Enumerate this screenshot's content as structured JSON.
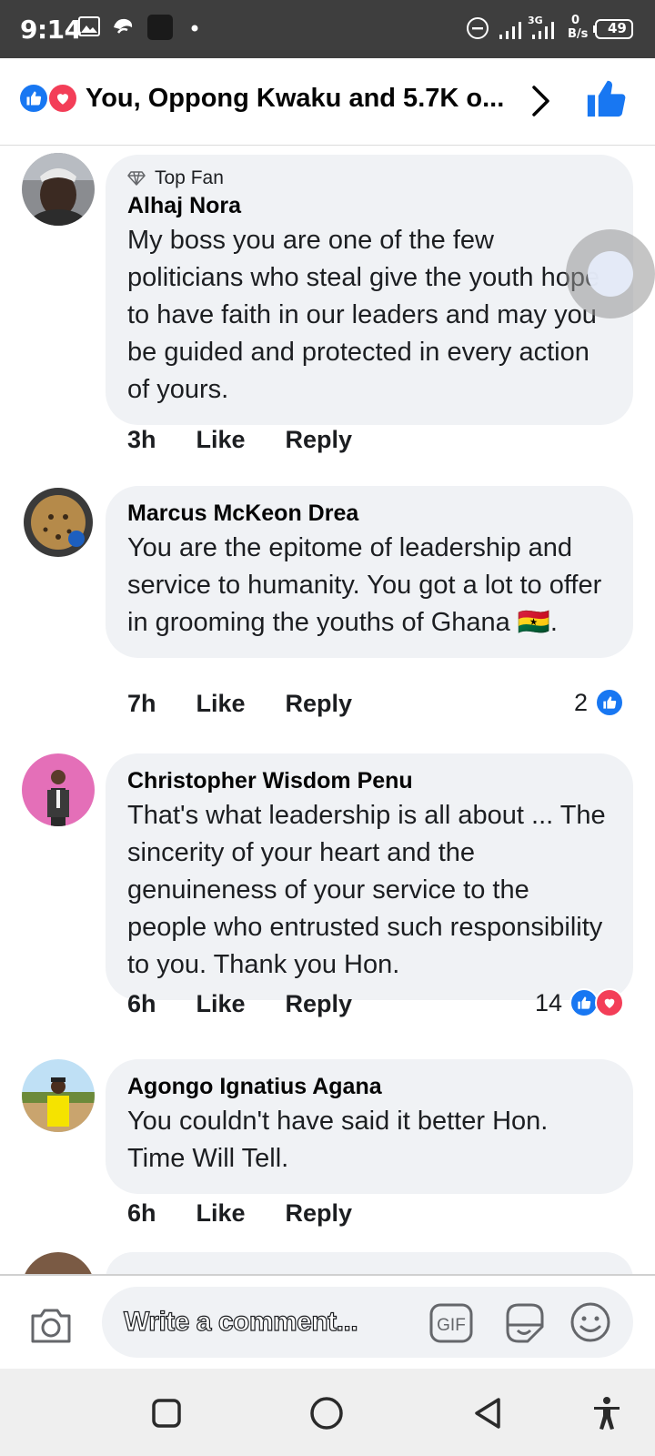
{
  "status_bar": {
    "time": "9:14",
    "network": "3G",
    "speed_value": "0",
    "speed_unit": "B/s",
    "battery": "49"
  },
  "header": {
    "title": "You, Oppong Kwaku and 5.7K o..."
  },
  "comments": [
    {
      "badge": "Top Fan",
      "author": "Alhaj Nora",
      "text": "My boss you are one of the few politicians who steal give the youth hope to have faith in our leaders and may you be guided and protected in every action of yours.",
      "time": "3h",
      "like_label": "Like",
      "reply_label": "Reply",
      "reaction_count": ""
    },
    {
      "badge": "",
      "author": "Marcus McKeon Drea",
      "text": "You are the epitome of leadership and service to humanity. You got a lot to offer in grooming the youths of Ghana 🇬🇭.",
      "time": "7h",
      "like_label": "Like",
      "reply_label": "Reply",
      "reaction_count": "2"
    },
    {
      "badge": "",
      "author": "Christopher Wisdom Penu",
      "text": "That's what leadership is all about ... The sincerity of your heart and the genuineness of your service to the people who entrusted such responsibility to you. Thank you Hon.",
      "time": "6h",
      "like_label": "Like",
      "reply_label": "Reply",
      "reaction_count": "14"
    },
    {
      "badge": "",
      "author": "Agongo Ignatius Agana",
      "text": "You couldn't have said it better Hon. Time Will Tell.",
      "time": "6h",
      "like_label": "Like",
      "reply_label": "Reply",
      "reaction_count": ""
    }
  ],
  "comment_bar": {
    "placeholder": "Write a comment...",
    "gif_label": "GIF"
  },
  "colors": {
    "facebook_blue": "#1877f2",
    "love_red": "#f33e58",
    "bubble_gray": "#f0f2f5"
  },
  "icons": [
    "like-reaction-icon",
    "love-reaction-icon",
    "chevron-right-icon",
    "thumbs-up-icon",
    "diamond-icon",
    "camera-icon",
    "gif-icon",
    "sticker-icon",
    "emoji-icon",
    "square-nav-icon",
    "circle-nav-icon",
    "back-triangle-icon",
    "accessibility-icon"
  ]
}
